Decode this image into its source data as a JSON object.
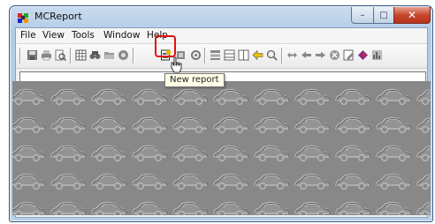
{
  "window": {
    "title": "MCReport",
    "controls": {
      "minimize": "–",
      "maximize": "□",
      "close": "✕"
    }
  },
  "menu": [
    "File",
    "View",
    "Tools",
    "Window",
    "Help"
  ],
  "toolbar": {
    "icons": [
      "save-icon",
      "print-icon",
      "print-preview-icon",
      "grid-icon",
      "find-icon",
      "open-folder-icon",
      "database-icon",
      "new-report-icon",
      "export-icon",
      "settings-icon",
      "align-icon",
      "table-icon",
      "layout-icon",
      "undo-icon",
      "zoom-icon",
      "fit-icon",
      "back-icon",
      "forward-icon",
      "stop-icon",
      "edit-icon",
      "book-icon",
      "chart-icon"
    ],
    "highlight_color": "#e01010"
  },
  "address": {
    "value": ""
  },
  "tooltip": {
    "text": "New report"
  },
  "workspace": {
    "pattern": "embossed-car-tile",
    "background": "#888888"
  }
}
